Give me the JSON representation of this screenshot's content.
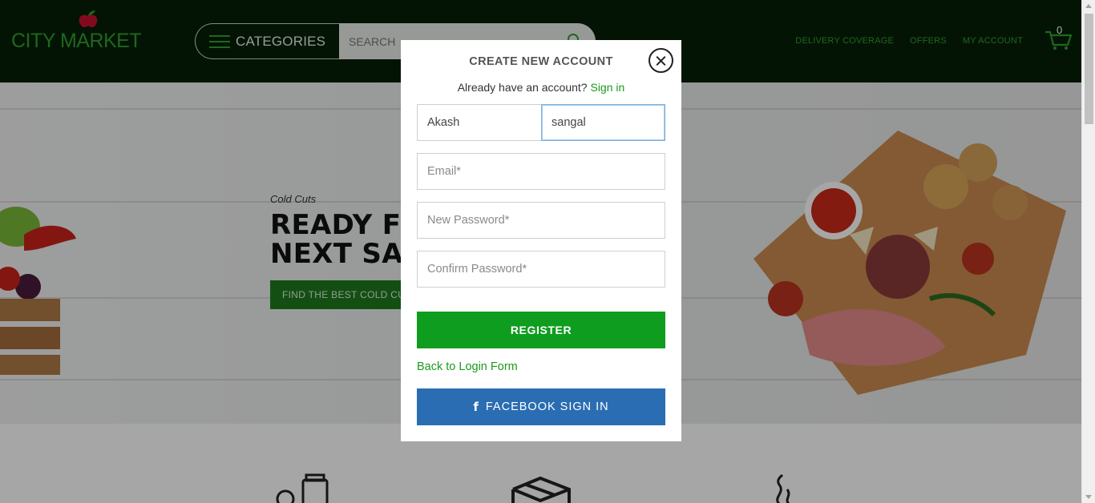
{
  "header": {
    "logo_text": "CITY MARKET",
    "categories_label": "CATEGORIES",
    "search_placeholder": "SEARCH",
    "nav": [
      {
        "label": "DELIVERY COVERAGE"
      },
      {
        "label": "OFFERS"
      },
      {
        "label": "MY ACCOUNT"
      }
    ],
    "cart_count": "0"
  },
  "hero": {
    "subtitle": "Cold Cuts",
    "title_line1": "READY FO",
    "title_line2": "NEXT SAN",
    "button_label": "FIND THE BEST COLD CU"
  },
  "modal": {
    "title": "CREATE NEW ACCOUNT",
    "signin_prompt": "Already have an account?",
    "signin_link": "Sign in",
    "first_name_value": "Akash",
    "last_name_value": "sangal",
    "email_placeholder": "Email*",
    "password_placeholder": "New Password*",
    "confirm_placeholder": "Confirm Password*",
    "register_label": "REGISTER",
    "back_link": "Back to Login Form",
    "facebook_label": "FACEBOOK SIGN IN"
  },
  "colors": {
    "header_bg": "#071f07",
    "brand_green": "#2e9e2e",
    "register_green": "#0f9d1f",
    "facebook_blue": "#2a6db3"
  }
}
